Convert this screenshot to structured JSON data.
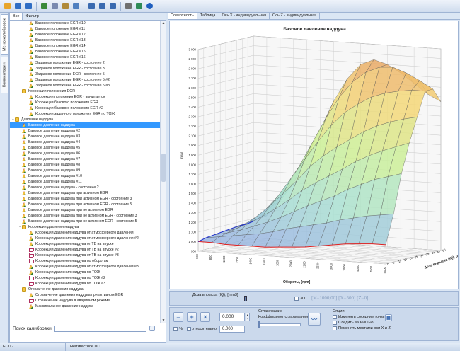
{
  "toolbar": {
    "icons": [
      "open-icon",
      "save-icon",
      "save-as-icon",
      "import-icon",
      "copy-icon",
      "paste-icon",
      "undo-icon",
      "compare-icon",
      "navigate-icon",
      "search-icon",
      "settings-icon",
      "reload-icon",
      "help-icon"
    ]
  },
  "left_tabs": {
    "calibration_menu": "Меню калибровок",
    "comments": "Комментарии"
  },
  "tree_tabs": {
    "all": "Все",
    "filter": "Фильтр"
  },
  "tree": [
    {
      "label": "Базовое положение EGR #10",
      "icon": "map",
      "level": 2
    },
    {
      "label": "Базовое положение EGR #11",
      "icon": "map",
      "level": 2
    },
    {
      "label": "Базовое положение EGR #12",
      "icon": "map",
      "level": 2
    },
    {
      "label": "Базовое положение EGR #13",
      "icon": "map",
      "level": 2
    },
    {
      "label": "Базовое положение EGR #14",
      "icon": "map",
      "level": 2
    },
    {
      "label": "Базовое положение EGR #15",
      "icon": "map",
      "level": 2
    },
    {
      "label": "Базовое положение EGR #16",
      "icon": "map",
      "level": 2
    },
    {
      "label": "Заданное положение EGR - состояние 2",
      "icon": "map",
      "level": 2
    },
    {
      "label": "Заданное положение EGR - состояние 3",
      "icon": "map",
      "level": 2
    },
    {
      "label": "Заданное положение EGR - состояние 5",
      "icon": "map",
      "level": 2
    },
    {
      "label": "Заданное положение EGR - состояние 5 #2",
      "icon": "map",
      "level": 2
    },
    {
      "label": "Заданное положение EGR - состояние 5 #3",
      "icon": "map",
      "level": 2
    },
    {
      "label": "Коррекция положения EGR",
      "icon": "folder",
      "level": 1,
      "expander": "−"
    },
    {
      "label": "Коррекция положения EGR - вычитается",
      "icon": "map",
      "level": 2
    },
    {
      "label": "Коррекция базового положения EGR",
      "icon": "map",
      "level": 2
    },
    {
      "label": "Коррекция базового положения EGR #2",
      "icon": "map",
      "level": 2
    },
    {
      "label": "Коррекция заданного положения EGR по ТОЖ",
      "icon": "map",
      "level": 2
    },
    {
      "label": "Давление наддува",
      "icon": "folder",
      "level": 0,
      "expander": "−"
    },
    {
      "label": "Базовое давление наддува",
      "icon": "map",
      "level": 1,
      "selected": true
    },
    {
      "label": "Базовое давление наддува #2",
      "icon": "map",
      "level": 1
    },
    {
      "label": "Базовое давление наддува #3",
      "icon": "map",
      "level": 1
    },
    {
      "label": "Базовое давление наддува #4",
      "icon": "map",
      "level": 1
    },
    {
      "label": "Базовое давление наддува #5",
      "icon": "map",
      "level": 1
    },
    {
      "label": "Базовое давление наддува #6",
      "icon": "map",
      "level": 1
    },
    {
      "label": "Базовое давление наддува #7",
      "icon": "map",
      "level": 1
    },
    {
      "label": "Базовое давление наддува #8",
      "icon": "map",
      "level": 1
    },
    {
      "label": "Базовое давление наддува #9",
      "icon": "map",
      "level": 1
    },
    {
      "label": "Базовое давление наддува #10",
      "icon": "map",
      "level": 1
    },
    {
      "label": "Базовое давление наддува #11",
      "icon": "map",
      "level": 1
    },
    {
      "label": "Базовое давление наддува - состояние 2",
      "icon": "map",
      "level": 1
    },
    {
      "label": "Базовое давление наддува при активном EGR",
      "icon": "map",
      "level": 1
    },
    {
      "label": "Базовое давление наддува при активном EGR - состояние 3",
      "icon": "map",
      "level": 1
    },
    {
      "label": "Базовое давление наддува при активном EGR - состояние 5",
      "icon": "map",
      "level": 1
    },
    {
      "label": "Базовое давление наддува при не активном EGR",
      "icon": "map",
      "level": 1
    },
    {
      "label": "Базовое давление наддува при не активном EGR - состояние 3",
      "icon": "map",
      "level": 1
    },
    {
      "label": "Базовое давление наддува при не активном EGR - состояние 5",
      "icon": "map",
      "level": 1
    },
    {
      "label": "Коррекция давления наддува",
      "icon": "folder",
      "level": 1,
      "expander": "−"
    },
    {
      "label": "Коррекция давления наддува от атмосферного давления",
      "icon": "map",
      "level": 2
    },
    {
      "label": "Коррекция давления наддува от атмосферного давления #2",
      "icon": "map",
      "level": 2
    },
    {
      "label": "Коррекция давления наддува от ТВ на впуске",
      "icon": "map",
      "level": 2
    },
    {
      "label": "Коррекция давления наддува от ТВ на впуске #2",
      "icon": "curve",
      "level": 2
    },
    {
      "label": "Коррекция давления наддува от ТВ на впуске #3",
      "icon": "curve",
      "level": 2
    },
    {
      "label": "Коррекция давления наддува по оборотам",
      "icon": "curve",
      "level": 2
    },
    {
      "label": "Коррекция давления наддува от атмосферного давления #3",
      "icon": "map",
      "level": 2
    },
    {
      "label": "Коррекция давления наддува по ТОЖ",
      "icon": "map",
      "level": 2
    },
    {
      "label": "Коррекция давления наддува по ТОЖ #2",
      "icon": "curve",
      "level": 2
    },
    {
      "label": "Коррекция давления наддува по ТОЖ #3",
      "icon": "curve",
      "level": 2
    },
    {
      "label": "Ограничение давления наддува",
      "icon": "folder",
      "level": 1,
      "expander": "−"
    },
    {
      "label": "Ограничение давления наддува при активном EGR",
      "icon": "map",
      "level": 2
    },
    {
      "label": "Ограничение наддува в аварийном режиме",
      "icon": "curve",
      "level": 2
    },
    {
      "label": "Максимальное давление наддува",
      "icon": "map",
      "level": 2
    }
  ],
  "search": {
    "label": "Поиск калибровки"
  },
  "right_tabs": [
    "Поверхность",
    "Таблица",
    "Ось X - индивидуальная",
    "Ось Z - индивидуальная"
  ],
  "slider": {
    "label": "Доза впрыска (IQ), [mm3]",
    "checkbox_label": "3D",
    "readout": "[V=1000,00] [X=500] [Z=0]"
  },
  "controls": {
    "value1": "0,000",
    "value2": "0,000",
    "pct_label": "%",
    "relative_label": "относительно",
    "smoothing_title": "Сглаживание",
    "smoothing_coef_label": "Коэффициент сглаживания",
    "options_title": "Опции",
    "opt_change_adjacent": "Изменять соседние точки",
    "opt_follow_mouse": "Следить за мышью",
    "opt_swap_axes": "Поменять местами оси X и Z"
  },
  "status": {
    "left": "ECU -",
    "middle": "Неизвестное ПО"
  },
  "chart_data": {
    "type": "surface3d",
    "title": "Базовое давление наддува",
    "zlabel": "mbar",
    "xlabel": "Обороты, [rpm]",
    "ylabel": "Доза впрыска (IQ), [mm3]",
    "x_ticks": [
      "600",
      "800",
      "1000",
      "1200",
      "1400",
      "1600",
      "1800",
      "2000",
      "2200",
      "2500",
      "3000",
      "3500",
      "4000",
      "4500",
      "5000"
    ],
    "z_ticks": [
      "900",
      "1 000",
      "1 100",
      "1 200",
      "1 300",
      "1 400",
      "1 500",
      "1 600",
      "1 700",
      "1 800",
      "1 900",
      "2 000",
      "2 100",
      "2 200",
      "2 300",
      "2 400",
      "2 500",
      "2 600",
      "2 700",
      "2 800",
      "2 900",
      "3 000"
    ],
    "zlim": [
      900,
      3000
    ],
    "y_ticks": [
      "0",
      "5",
      "10",
      "15",
      "20",
      "25",
      "30",
      "35",
      "40",
      "45",
      "50"
    ],
    "rows": 8,
    "cols": 15,
    "z_values": [
      [
        1000,
        1000,
        990,
        990,
        990,
        990,
        1000,
        1010,
        1020,
        1040,
        1060,
        1080,
        1090,
        1100,
        1100
      ],
      [
        1020,
        1040,
        1060,
        1080,
        1100,
        1130,
        1170,
        1200,
        1230,
        1260,
        1300,
        1330,
        1360,
        1380,
        1400
      ],
      [
        1030,
        1060,
        1100,
        1150,
        1200,
        1260,
        1330,
        1400,
        1460,
        1520,
        1600,
        1660,
        1720,
        1760,
        1800
      ],
      [
        1040,
        1080,
        1150,
        1230,
        1320,
        1420,
        1530,
        1620,
        1700,
        1780,
        1870,
        1940,
        2000,
        2050,
        2100
      ],
      [
        1050,
        1100,
        1200,
        1320,
        1460,
        1600,
        1760,
        1880,
        1980,
        2070,
        2160,
        2230,
        2280,
        2320,
        2350
      ],
      [
        1060,
        1120,
        1240,
        1400,
        1600,
        1800,
        2000,
        2180,
        2320,
        2420,
        2500,
        2550,
        2580,
        2600,
        2600
      ],
      [
        1060,
        1130,
        1270,
        1460,
        1700,
        1960,
        2220,
        2450,
        2620,
        2730,
        2790,
        2800,
        2750,
        2680,
        2600
      ],
      [
        1070,
        1140,
        1300,
        1500,
        1780,
        2080,
        2380,
        2620,
        2780,
        2840,
        2800,
        2720,
        2620,
        2520,
        2450
      ]
    ]
  }
}
